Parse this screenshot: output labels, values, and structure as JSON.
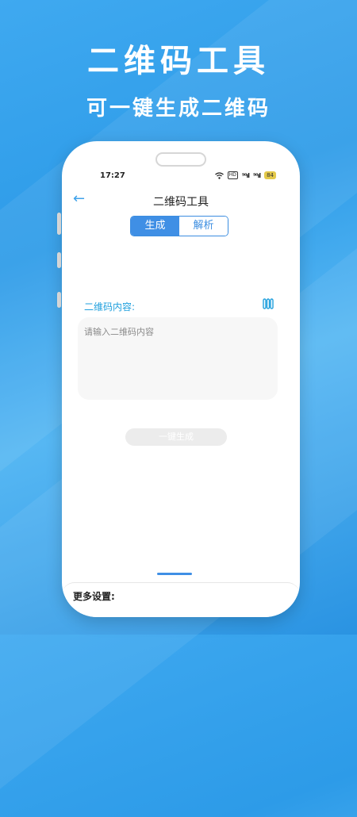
{
  "promo": {
    "title": "二维码工具",
    "subtitle": "可一键生成二维码"
  },
  "status_bar": {
    "time": "17:27",
    "hd_badge": "HD",
    "signal1": "⁵ᴳıl",
    "signal2": "⁵ᴳıl",
    "battery": "84"
  },
  "nav": {
    "title": "二维码工具",
    "back_icon": "arrow-left-icon"
  },
  "segments": {
    "generate": "生成",
    "parse": "解析",
    "selected": "生成"
  },
  "content": {
    "label": "二维码内容:",
    "placeholder": "请输入二维码内容",
    "value": ""
  },
  "actions": {
    "generate_button": "一键生成"
  },
  "settings": {
    "label": "更多设置:"
  },
  "colors": {
    "accent": "#3f8fe5",
    "label_teal": "#1f9fdd",
    "background": "#2d9be8"
  }
}
